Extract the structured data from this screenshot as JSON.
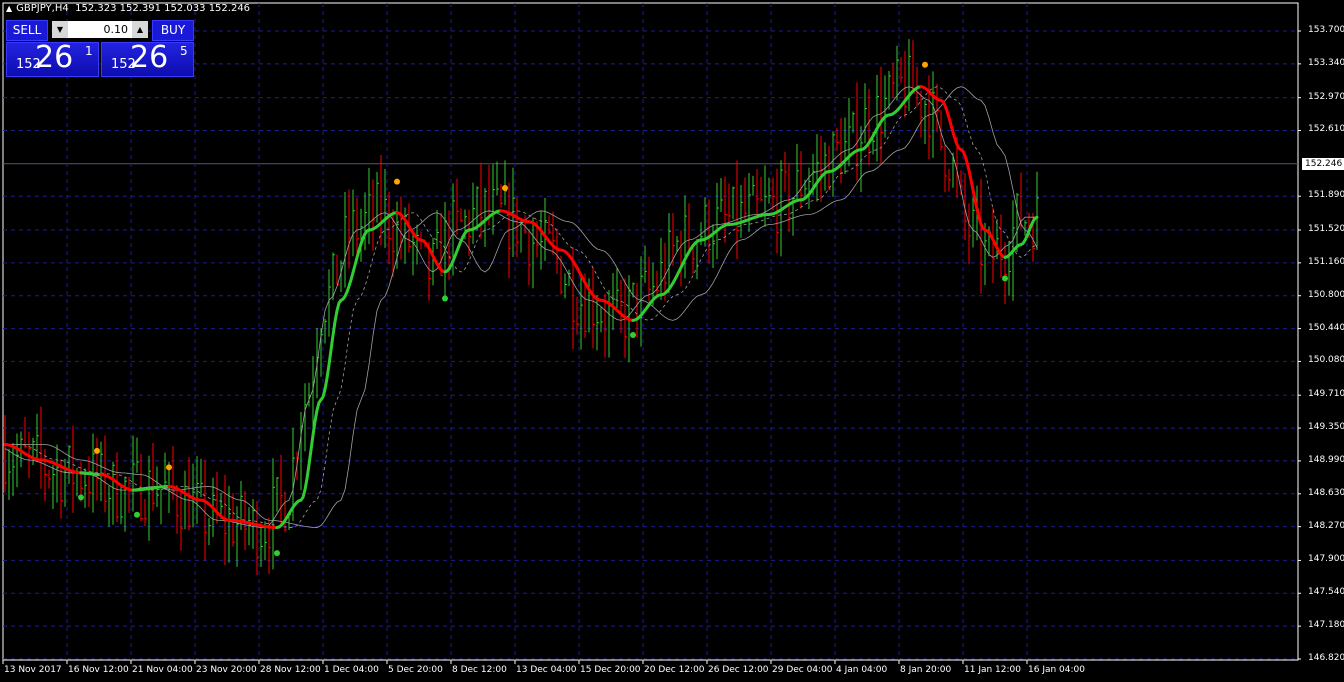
{
  "header": {
    "symbol": "GBPJPY,H4",
    "ohlc": "152.323 152.391 152.033 152.246"
  },
  "trade_panel": {
    "sell_label": "SELL",
    "buy_label": "BUY",
    "lot": "0.10",
    "bid": {
      "prefix": "152",
      "big": "26",
      "sup": "1"
    },
    "ask": {
      "prefix": "152",
      "big": "26",
      "sup": "5"
    }
  },
  "colors": {
    "background": "#000000",
    "grid": "#1e1e8c",
    "bull": "#32cd32",
    "bear": "#ff0000",
    "ma_up": "#32cd32",
    "ma_down": "#ff0000",
    "band": "#a0a0a0",
    "dot_top": "#ffa500",
    "dot_bottom": "#32cd32",
    "panel": "#1a1ad6"
  },
  "chart_data": {
    "type": "line",
    "instrument": "GBPJPY",
    "timeframe": "H4",
    "ylim": [
      146.82,
      153.7
    ],
    "y_ticks": [
      "153.700",
      "153.340",
      "152.970",
      "152.610",
      "152.246",
      "151.890",
      "151.520",
      "151.160",
      "150.800",
      "150.440",
      "150.080",
      "149.710",
      "149.350",
      "148.990",
      "148.630",
      "148.270",
      "147.900",
      "147.540",
      "147.180",
      "146.820"
    ],
    "current_price": "152.246",
    "x_ticks": [
      "13 Nov 2017",
      "16 Nov 12:00",
      "21 Nov 04:00",
      "23 Nov 20:00",
      "28 Nov 12:00",
      "1 Dec 04:00",
      "5 Dec 20:00",
      "8 Dec 12:00",
      "13 Dec 04:00",
      "15 Dec 20:00",
      "20 Dec 12:00",
      "26 Dec 12:00",
      "29 Dec 04:00",
      "4 Jan 04:00",
      "8 Jan 20:00",
      "11 Jan 12:00",
      "16 Jan 04:00"
    ],
    "bars_per_tick": 16,
    "ma_points": [
      [
        0,
        149.17,
        "down"
      ],
      [
        9,
        149.0,
        "down"
      ],
      [
        19,
        148.86,
        "up"
      ],
      [
        24,
        148.84,
        "down"
      ],
      [
        32,
        148.67,
        "up"
      ],
      [
        41,
        148.71,
        "down"
      ],
      [
        49,
        148.56,
        "down"
      ],
      [
        56,
        148.34,
        "down"
      ],
      [
        68,
        148.26,
        "up"
      ],
      [
        74,
        148.56,
        "up"
      ],
      [
        79,
        149.66,
        "up"
      ],
      [
        84,
        150.75,
        "up"
      ],
      [
        91,
        151.52,
        "up"
      ],
      [
        98,
        151.71,
        "down"
      ],
      [
        104,
        151.41,
        "down"
      ],
      [
        110,
        151.06,
        "up"
      ],
      [
        116,
        151.52,
        "up"
      ],
      [
        124,
        151.73,
        "down"
      ],
      [
        131,
        151.61,
        "down"
      ],
      [
        139,
        151.3,
        "down"
      ],
      [
        149,
        150.75,
        "down"
      ],
      [
        157,
        150.53,
        "up"
      ],
      [
        164,
        150.81,
        "up"
      ],
      [
        174,
        151.41,
        "up"
      ],
      [
        181,
        151.58,
        "up"
      ],
      [
        191,
        151.69,
        "up"
      ],
      [
        199,
        151.85,
        "up"
      ],
      [
        206,
        152.16,
        "up"
      ],
      [
        214,
        152.4,
        "up"
      ],
      [
        221,
        152.78,
        "up"
      ],
      [
        229,
        153.09,
        "down"
      ],
      [
        234,
        152.94,
        "down"
      ],
      [
        239,
        152.4,
        "down"
      ],
      [
        245,
        151.52,
        "down"
      ],
      [
        250,
        151.22,
        "up"
      ],
      [
        254,
        151.36,
        "up"
      ],
      [
        258,
        151.66,
        "up"
      ]
    ],
    "signal_dots": [
      {
        "bar": 23,
        "price": 149.1,
        "kind": "top"
      },
      {
        "bar": 41,
        "price": 148.92,
        "kind": "top"
      },
      {
        "bar": 98,
        "price": 152.05,
        "kind": "top"
      },
      {
        "bar": 125,
        "price": 151.98,
        "kind": "top"
      },
      {
        "bar": 230,
        "price": 153.33,
        "kind": "top"
      },
      {
        "bar": 19,
        "price": 148.59,
        "kind": "bottom"
      },
      {
        "bar": 33,
        "price": 148.4,
        "kind": "bottom"
      },
      {
        "bar": 68,
        "price": 147.98,
        "kind": "bottom"
      },
      {
        "bar": 110,
        "price": 150.77,
        "kind": "bottom"
      },
      {
        "bar": 157,
        "price": 150.37,
        "kind": "bottom"
      },
      {
        "bar": 250,
        "price": 150.99,
        "kind": "bottom"
      }
    ]
  }
}
